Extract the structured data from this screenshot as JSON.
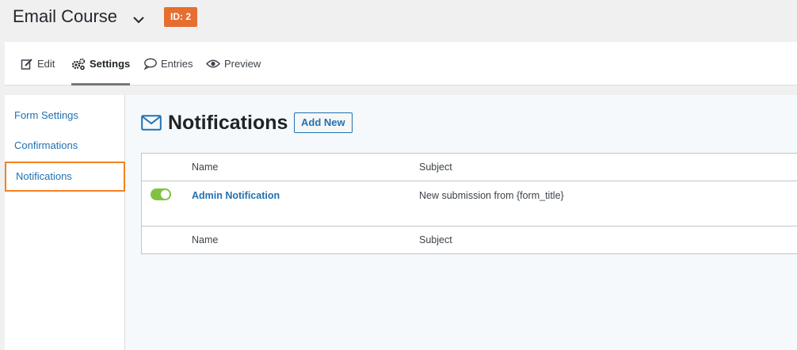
{
  "header": {
    "title": "Email Course",
    "id_badge": "ID: 2"
  },
  "tabs": [
    {
      "label": "Edit",
      "icon": "edit-icon"
    },
    {
      "label": "Settings",
      "icon": "gears-icon",
      "active": true
    },
    {
      "label": "Entries",
      "icon": "speech-bubble-icon"
    },
    {
      "label": "Preview",
      "icon": "eye-icon"
    }
  ],
  "sidebar": {
    "items": [
      {
        "label": "Form Settings"
      },
      {
        "label": "Confirmations"
      },
      {
        "label": "Notifications",
        "active": true
      }
    ]
  },
  "main": {
    "heading": "Notifications",
    "heading_icon": "envelope-icon",
    "add_new_label": "Add New",
    "table": {
      "columns": [
        "Name",
        "Subject"
      ],
      "rows": [
        {
          "name": "Admin Notification",
          "subject": "New submission from {form_title}",
          "enabled": true
        }
      ]
    }
  },
  "colors": {
    "accent": "#2271b1",
    "badge": "#e66e31",
    "highlight_outline": "#f48120",
    "toggle_on": "#81c341"
  }
}
